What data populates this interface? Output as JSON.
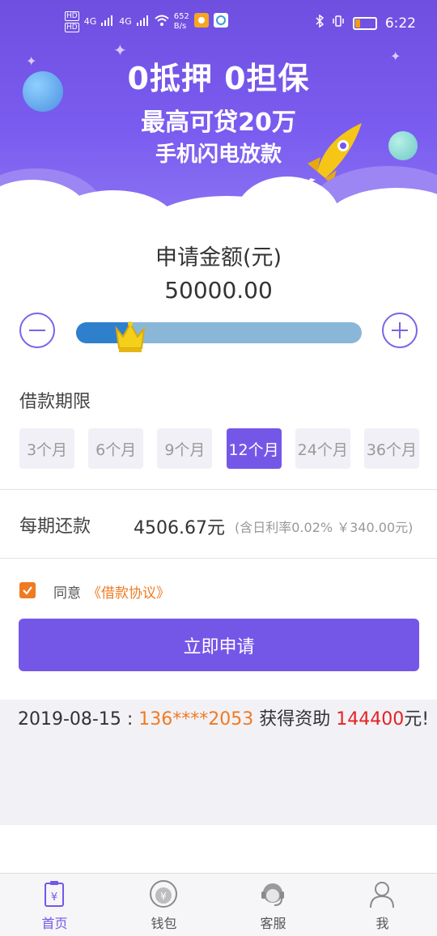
{
  "status_bar": {
    "hd1": "HD",
    "hd2": "HD",
    "net1": "4G",
    "net2": "4G",
    "speed_value": "652",
    "speed_unit": "B/s",
    "time": "6:22"
  },
  "banner": {
    "line1": "0抵押  0担保",
    "line2": "最高可贷20万",
    "line3": "手机闪电放款"
  },
  "loan": {
    "amount_title": "申请金额(元)",
    "amount_value": "50000.00",
    "slider_fraction": 0.19
  },
  "term": {
    "label": "借款期限",
    "options": [
      "3个月",
      "6个月",
      "9个月",
      "12个月",
      "24个月",
      "36个月"
    ],
    "selected_index": 3
  },
  "repayment": {
    "label": "每期还款",
    "value": "4506.67元",
    "note": "(含日利率0.02% ￥340.00元)"
  },
  "agreement": {
    "checked": true,
    "text": "同意",
    "link": "《借款协议》"
  },
  "apply_button": "立即申请",
  "ticker": {
    "date": "2019-08-15 : ",
    "phone": "136****2053",
    "middle": " 获得资助 ",
    "amount": "144400",
    "suffix": "元!"
  },
  "tabbar": {
    "items": [
      {
        "label": "首页",
        "icon": "home-icon"
      },
      {
        "label": "钱包",
        "icon": "wallet-icon"
      },
      {
        "label": "客服",
        "icon": "service-icon"
      },
      {
        "label": "我",
        "icon": "profile-icon"
      }
    ],
    "active_index": 0
  },
  "colors": {
    "primary": "#7557e8",
    "accent": "#f07a22",
    "highlight": "#e52222",
    "slider_fill": "#2f80cc",
    "slider_track": "#8ab7d8"
  }
}
